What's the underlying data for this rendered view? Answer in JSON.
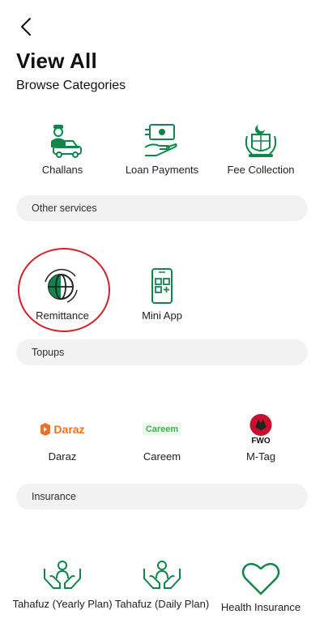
{
  "header": {
    "title": "View All",
    "subtitle": "Browse Categories"
  },
  "categories": [
    {
      "label": "Challans",
      "icon": "challan-car-icon"
    },
    {
      "label": "Loan Payments",
      "icon": "loan-payment-icon"
    },
    {
      "label": "Fee Collection",
      "icon": "emblem-icon"
    }
  ],
  "sections": {
    "other_services": {
      "title": "Other services",
      "items": [
        {
          "label": "Remittance",
          "icon": "globe-icon",
          "highlighted": true
        },
        {
          "label": "Mini App",
          "icon": "mobile-app-icon"
        }
      ]
    },
    "topups": {
      "title": "Topups",
      "items": [
        {
          "label": "Daraz",
          "logo_text": "Daraz",
          "icon": "daraz-logo"
        },
        {
          "label": "Careem",
          "logo_text": "Careem",
          "icon": "careem-logo"
        },
        {
          "label": "M-Tag",
          "logo_text": "FWO",
          "icon": "fwo-logo"
        }
      ]
    },
    "insurance": {
      "title": "Insurance",
      "items": [
        {
          "label": "Tahafuz (Yearly Plan)",
          "icon": "hands-protect-icon"
        },
        {
          "label": "Tahafuz (Daily Plan)",
          "icon": "hands-protect-icon"
        },
        {
          "label": "Health Insurance",
          "icon": "heart-icon"
        }
      ]
    }
  },
  "colors": {
    "brand_green": "#10864a",
    "highlight_red": "#d1202a",
    "pill_bg": "#f2f2f2",
    "daraz_orange": "#f36f21",
    "fwo_red": "#c8102e"
  }
}
